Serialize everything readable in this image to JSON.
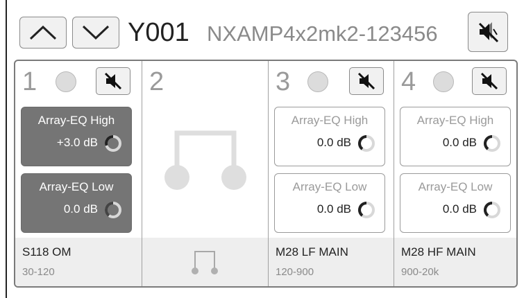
{
  "header": {
    "device_id": "Y001",
    "device_name": "NXAMP4x2mk2-123456",
    "nav_up_icon": "chevron-up-icon",
    "nav_down_icon": "chevron-down-icon",
    "mute_all_icon": "speaker-mute-all-icon"
  },
  "channels": [
    {
      "number": "1",
      "eq_high": {
        "label": "Array-EQ High",
        "value": "+3.0 dB",
        "active": true
      },
      "eq_low": {
        "label": "Array-EQ Low",
        "value": "0.0 dB",
        "active": true
      },
      "speaker": "S118 OM",
      "range": "30-120"
    },
    {
      "number": "2",
      "bridged_icon": "bridge-link-icon"
    },
    {
      "number": "3",
      "eq_high": {
        "label": "Array-EQ High",
        "value": "0.0 dB",
        "active": false
      },
      "eq_low": {
        "label": "Array-EQ Low",
        "value": "0.0 dB",
        "active": false
      },
      "speaker": "M28 LF MAIN",
      "range": "120-900"
    },
    {
      "number": "4",
      "eq_high": {
        "label": "Array-EQ High",
        "value": "0.0 dB",
        "active": false
      },
      "eq_low": {
        "label": "Array-EQ Low",
        "value": "0.0 dB",
        "active": false
      },
      "speaker": "M28 HF MAIN",
      "range": "900-20k"
    }
  ],
  "colors": {
    "active_eq_bg": "#757575",
    "led_off": "#dcdcdc",
    "footer_bg": "#eeeeee"
  }
}
